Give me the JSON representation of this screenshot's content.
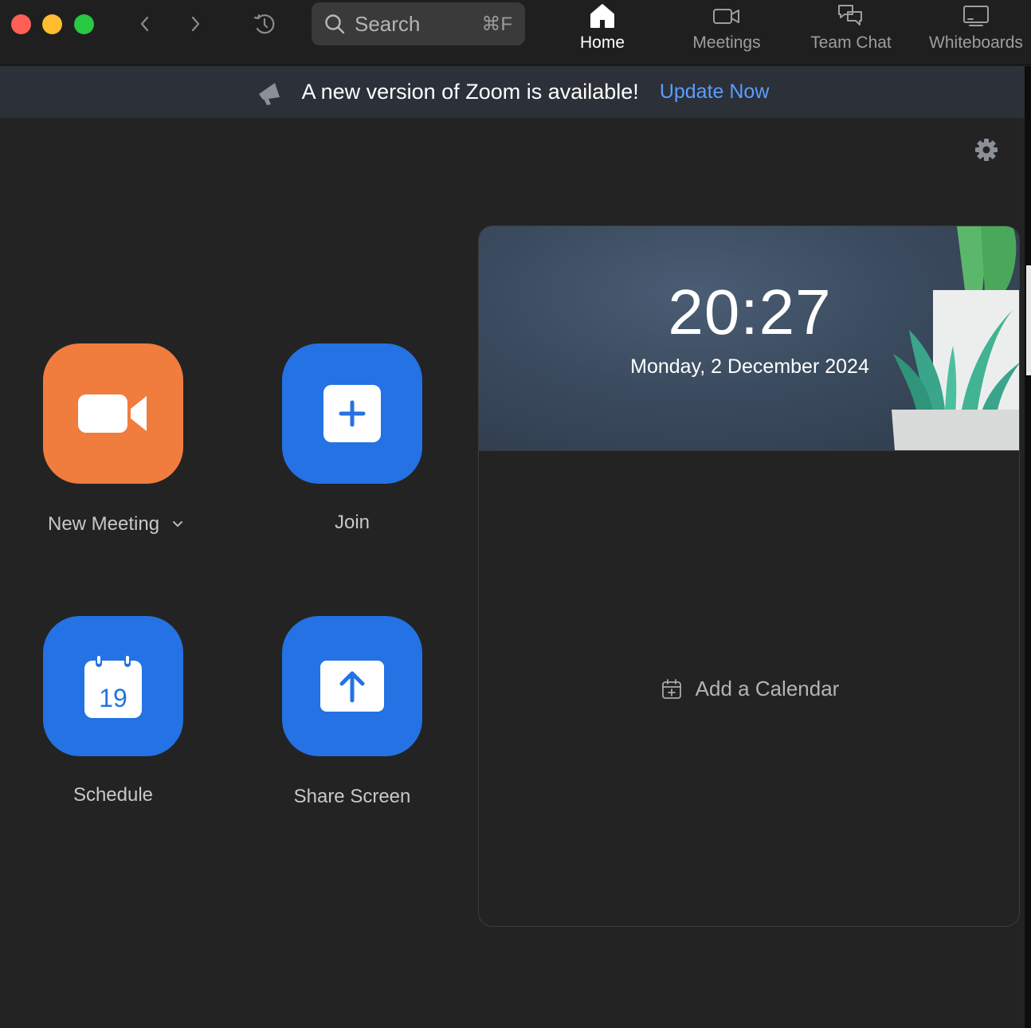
{
  "titlebar": {
    "search": {
      "placeholder": "Search",
      "shortcut": "⌘F",
      "icon": "search-icon"
    },
    "tabs": [
      {
        "label": "Home",
        "icon": "home-icon",
        "active": true
      },
      {
        "label": "Meetings",
        "icon": "video-camera-icon",
        "active": false
      },
      {
        "label": "Team Chat",
        "icon": "chat-bubbles-icon",
        "active": false
      },
      {
        "label": "Whiteboards",
        "icon": "whiteboard-icon",
        "active": false
      }
    ]
  },
  "banner": {
    "message": "A new version of Zoom is available!",
    "action": "Update Now"
  },
  "actions": {
    "new_meeting": {
      "label": "New Meeting",
      "color": "#f07c3e"
    },
    "join": {
      "label": "Join",
      "color": "#2472e3"
    },
    "schedule": {
      "label": "Schedule",
      "calendar_day": "19",
      "color": "#2472e3"
    },
    "share_screen": {
      "label": "Share Screen",
      "color": "#2472e3"
    }
  },
  "calendar_card": {
    "time": "20:27",
    "date": "Monday, 2 December 2024",
    "add_calendar": "Add a Calendar"
  },
  "colors": {
    "accent_link": "#5a9dff",
    "background": "#232323"
  }
}
